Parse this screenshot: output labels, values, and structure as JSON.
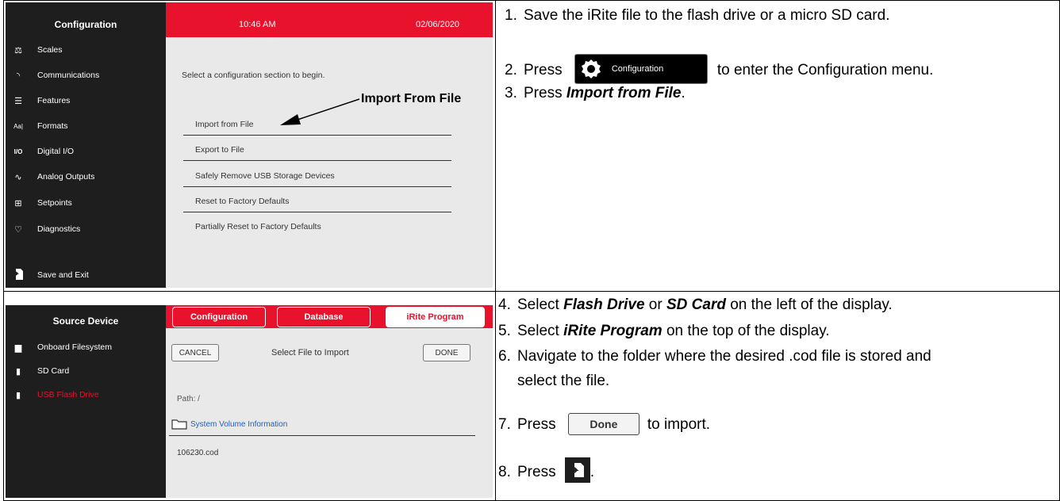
{
  "top": {
    "sidebar": {
      "title": "Configuration",
      "items": [
        {
          "icon": "scales-icon",
          "label": "Scales"
        },
        {
          "icon": "communications-icon",
          "label": "Communications"
        },
        {
          "icon": "features-icon",
          "label": "Features"
        },
        {
          "icon": "formats-icon",
          "label": "Formats"
        },
        {
          "icon": "digital-io-icon",
          "label": "Digital I/O"
        },
        {
          "icon": "analog-outputs-icon",
          "label": "Analog Outputs"
        },
        {
          "icon": "setpoints-icon",
          "label": "Setpoints"
        },
        {
          "icon": "diagnostics-icon",
          "label": "Diagnostics"
        }
      ],
      "save_label": "Save and Exit"
    },
    "header": {
      "time": "10:46 AM",
      "date": "02/06/2020"
    },
    "prompt": "Select a configuration section to begin.",
    "menu": [
      "Import from File",
      "Export to File",
      "Safely Remove USB Storage Devices",
      "Reset to Factory Defaults",
      "Partially Reset to Factory Defaults"
    ],
    "callout": "Import From File",
    "steps": [
      {
        "num": "1.",
        "text": "Save the iRite file to the flash drive or a micro SD card."
      },
      {
        "num": "2.",
        "pre": "Press",
        "button": "Configuration",
        "post": "to enter the Configuration menu."
      },
      {
        "num": "3.",
        "pre": "Press ",
        "bold": "Import from File",
        "post": "."
      }
    ]
  },
  "bottom": {
    "sidebar": {
      "title": "Source Device",
      "items": [
        "Onboard Filesystem",
        "SD Card",
        "USB Flash Drive"
      ],
      "selected_color": "#e8122d"
    },
    "tabs": [
      "Configuration",
      "Database",
      "iRite Program"
    ],
    "cancel": "CANCEL",
    "heading": "Select File to Import",
    "done": "DONE",
    "path": "Path: /",
    "folder": "System Volume Information",
    "file": "106230.cod",
    "steps": {
      "s4": {
        "num": "4.",
        "pre": "Select ",
        "b1": "Flash Drive",
        "mid": " or ",
        "b2": "SD Card",
        "post": " on the left of the display."
      },
      "s5": {
        "num": "5.",
        "pre": "Select ",
        "b1": "iRite Program",
        "post": " on the top of the display."
      },
      "s6": {
        "num": "6.",
        "line1": "Navigate to the folder where the desired .cod file is stored and",
        "line2": "select the file."
      },
      "s7": {
        "num": "7.",
        "pre": "Press",
        "button": "Done",
        "post": "to import."
      },
      "s8": {
        "num": "8.",
        "pre": "Press",
        "post": "."
      }
    }
  },
  "colors": {
    "accent": "#e8122d",
    "sidebar": "#1e1e1e",
    "panel": "#e9e9e9",
    "link": "#1f5fbf"
  }
}
